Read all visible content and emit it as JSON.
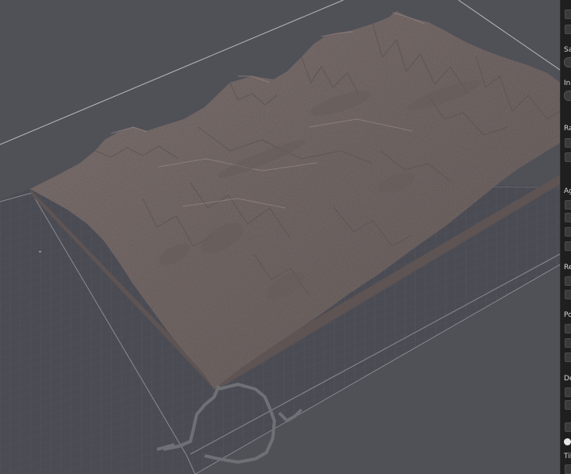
{
  "viewport": {
    "background_color": "#505057",
    "grid_color": "#5e5e66",
    "boundary_line_color": "#b8b8c0",
    "terrain_color": "#7a6f6c",
    "terrain_shadow_color": "#5d5453",
    "base_plate_color": "#4a4a52"
  },
  "side_panel": {
    "background_color": "#1f1f1f",
    "section_labels": [
      {
        "id": "sa",
        "text": "Sa"
      },
      {
        "id": "in",
        "text": "In"
      },
      {
        "id": "ra",
        "text": "Ra"
      },
      {
        "id": "ag",
        "text": "Ag"
      },
      {
        "id": "re",
        "text": "Re"
      },
      {
        "id": "po",
        "text": "Po"
      },
      {
        "id": "de",
        "text": "De"
      },
      {
        "id": "ti",
        "text": "Til"
      }
    ]
  }
}
